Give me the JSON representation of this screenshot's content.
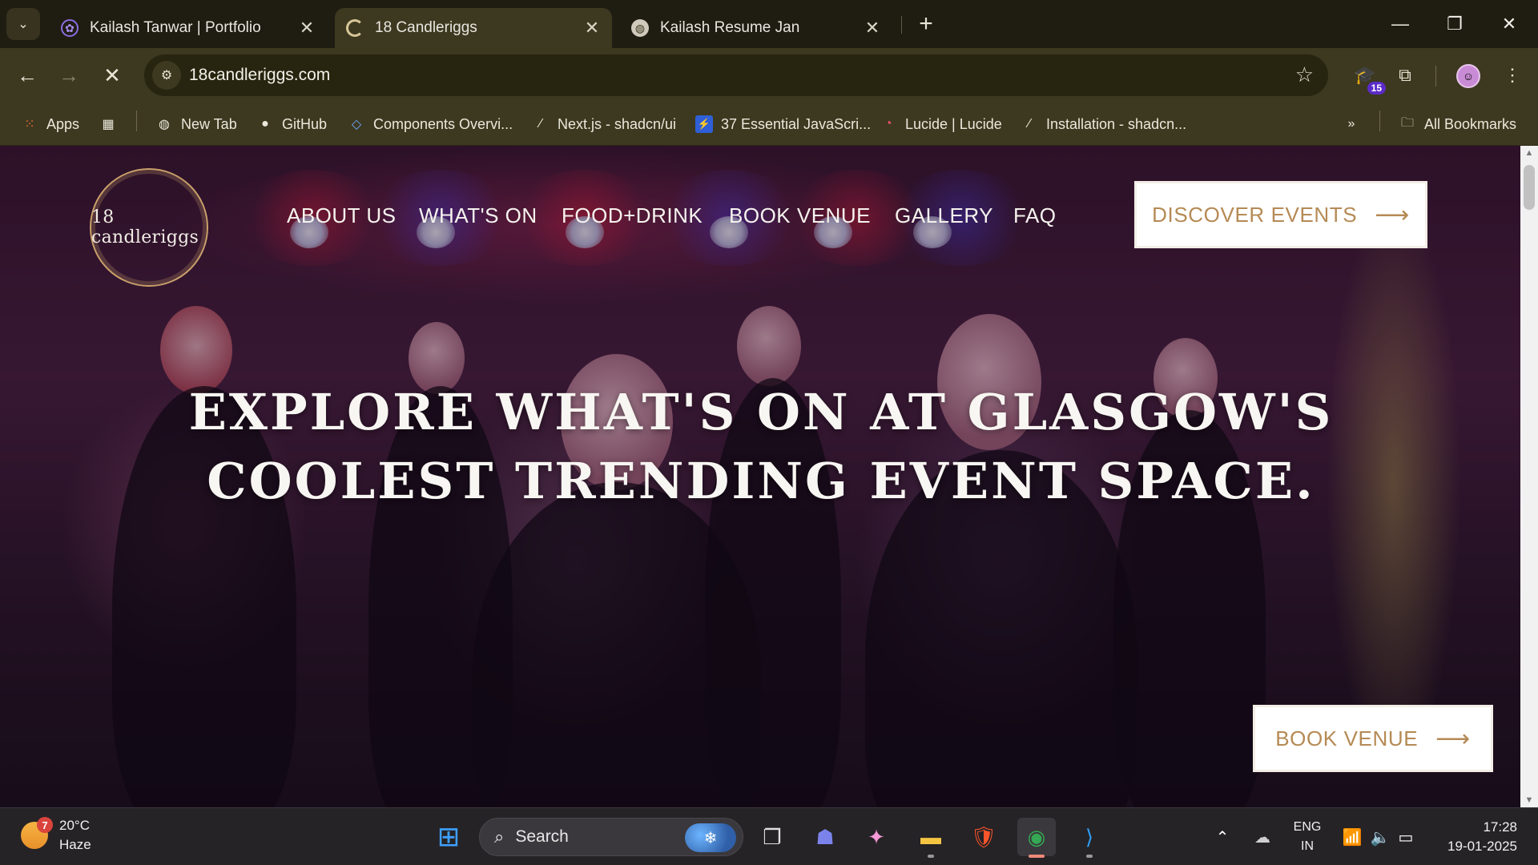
{
  "browser": {
    "tabs": [
      {
        "title": "Kailash Tanwar | Portfolio",
        "icon": "portfolio-favicon-icon",
        "active": false
      },
      {
        "title": "18 Candleriggs",
        "icon": "loading-spinner-icon",
        "active": true
      },
      {
        "title": "Kailash Resume Jan",
        "icon": "globe-icon",
        "active": false
      }
    ],
    "tab_close": "✕",
    "new_tab": "+",
    "url": "18candleriggs.com",
    "extension_badge": "15",
    "bookmarks": [
      {
        "label": "Apps",
        "icon": "apps-grid-icon"
      },
      {
        "label": "New Tab",
        "icon": "globe-icon"
      },
      {
        "label": "GitHub",
        "icon": "github-icon"
      },
      {
        "label": "Components Overvi...",
        "icon": "components-icon"
      },
      {
        "label": "Next.js - shadcn/ui",
        "icon": "shadcn-icon"
      },
      {
        "label": "37 Essential JavaScri...",
        "icon": "javascript-icon"
      },
      {
        "label": "Lucide | Lucide",
        "icon": "lucide-icon"
      },
      {
        "label": "Installation - shadcn...",
        "icon": "shadcn-icon"
      }
    ],
    "all_bookmarks": "All Bookmarks"
  },
  "site": {
    "logo_text": "18 candleriggs",
    "nav": [
      "ABOUT US",
      "WHAT'S ON",
      "FOOD+DRINK",
      "BOOK VENUE",
      "GALLERY",
      "FAQ"
    ],
    "cta_top": "DISCOVER EVENTS",
    "hero_title": "EXPLORE WHAT'S ON AT GLASGOW'S COOLEST TRENDING EVENT SPACE.",
    "cta_bottom": "BOOK VENUE",
    "accent_color": "#b58a55"
  },
  "taskbar": {
    "weather_temp": "20°C",
    "weather_desc": "Haze",
    "weather_badge": "7",
    "search_placeholder": "Search",
    "lang_line1": "ENG",
    "lang_line2": "IN",
    "time": "17:28",
    "date": "19-01-2025"
  }
}
